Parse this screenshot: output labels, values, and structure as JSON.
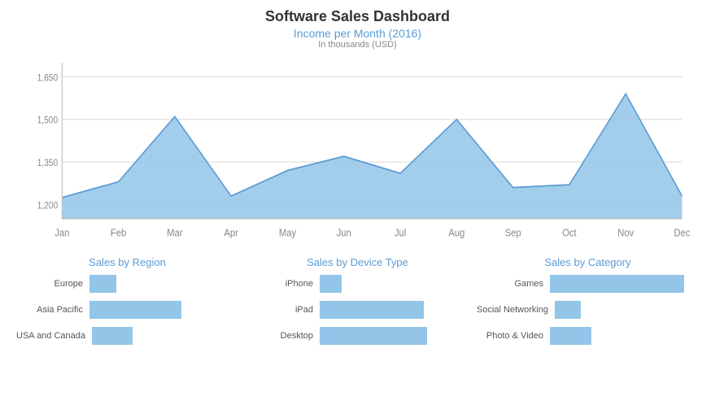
{
  "title": "Software Sales Dashboard",
  "area_chart": {
    "title": "Income per Month (2016)",
    "subtitle": "In thousands (USD)",
    "y_labels": [
      "1,200",
      "1,350",
      "1,500",
      "1,650"
    ],
    "x_labels": [
      "Jan",
      "Feb",
      "Mar",
      "Apr",
      "May",
      "Jun",
      "Jul",
      "Aug",
      "Sep",
      "Oct",
      "Nov",
      "Dec"
    ],
    "data_points": [
      1225,
      1280,
      1510,
      1230,
      1320,
      1370,
      1310,
      1500,
      1260,
      1270,
      1590,
      1230
    ]
  },
  "sales_by_region": {
    "title": "Sales by Region",
    "bars": [
      {
        "label": "Europe",
        "value": 18
      },
      {
        "label": "Asia Pacific",
        "value": 62
      },
      {
        "label": "USA and Canada",
        "value": 28
      }
    ]
  },
  "sales_by_device": {
    "title": "Sales by Device Type",
    "bars": [
      {
        "label": "iPhone",
        "value": 15
      },
      {
        "label": "iPad",
        "value": 70
      },
      {
        "label": "Desktop",
        "value": 72
      }
    ]
  },
  "sales_by_category": {
    "title": "Sales by Category",
    "bars": [
      {
        "label": "Games",
        "value": 90
      },
      {
        "label": "Social Networking",
        "value": 18
      },
      {
        "label": "Photo & Video",
        "value": 28
      }
    ]
  }
}
